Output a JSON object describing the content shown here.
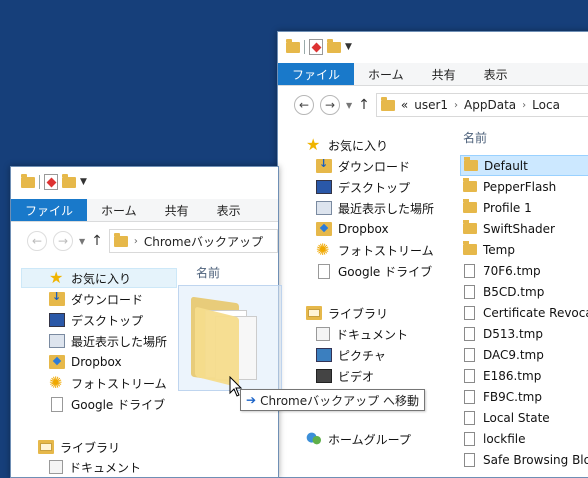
{
  "colors": {
    "desktop_bg": "#163f7a",
    "file_tab": "#1979ca",
    "selection": "#cce8ff"
  },
  "ribbon": {
    "file": "ファイル",
    "home": "ホーム",
    "share": "共有",
    "view": "表示"
  },
  "left_window": {
    "address": {
      "crumbs": [
        "Chromeバックアップ"
      ]
    },
    "column_header": "名前",
    "nav": {
      "favorites": "お気に入り",
      "items": [
        "ダウンロード",
        "デスクトップ",
        "最近表示した場所",
        "Dropbox",
        "フォトストリーム",
        "Google ドライブ"
      ],
      "libraries": "ライブラリ",
      "lib_items": [
        "ドキュメント"
      ]
    }
  },
  "right_window": {
    "address": {
      "prefix": "«",
      "crumbs": [
        "user1",
        "AppData",
        "Loca"
      ]
    },
    "column_header": "名前",
    "nav": {
      "favorites": "お気に入り",
      "items": [
        "ダウンロード",
        "デスクトップ",
        "最近表示した場所",
        "Dropbox",
        "フォトストリーム",
        "Google ドライブ"
      ],
      "libraries": "ライブラリ",
      "lib_items": [
        "ドキュメント",
        "ピクチャ",
        "ビデオ"
      ],
      "homegroup": "ホームグループ"
    },
    "files": [
      {
        "name": "Default",
        "type": "folder",
        "selected": true
      },
      {
        "name": "PepperFlash",
        "type": "folder"
      },
      {
        "name": "Profile 1",
        "type": "folder"
      },
      {
        "name": "SwiftShader",
        "type": "folder"
      },
      {
        "name": "Temp",
        "type": "folder"
      },
      {
        "name": "70F6.tmp",
        "type": "file"
      },
      {
        "name": "B5CD.tmp",
        "type": "file"
      },
      {
        "name": "Certificate Revoca",
        "type": "file"
      },
      {
        "name": "D513.tmp",
        "type": "file"
      },
      {
        "name": "DAC9.tmp",
        "type": "file"
      },
      {
        "name": "E186.tmp",
        "type": "file"
      },
      {
        "name": "FB9C.tmp",
        "type": "file"
      },
      {
        "name": "Local State",
        "type": "file"
      },
      {
        "name": "lockfile",
        "type": "file"
      },
      {
        "name": "Safe Browsing Blo",
        "type": "file"
      }
    ]
  },
  "drag": {
    "tooltip": "Chromeバックアップ へ移動"
  }
}
